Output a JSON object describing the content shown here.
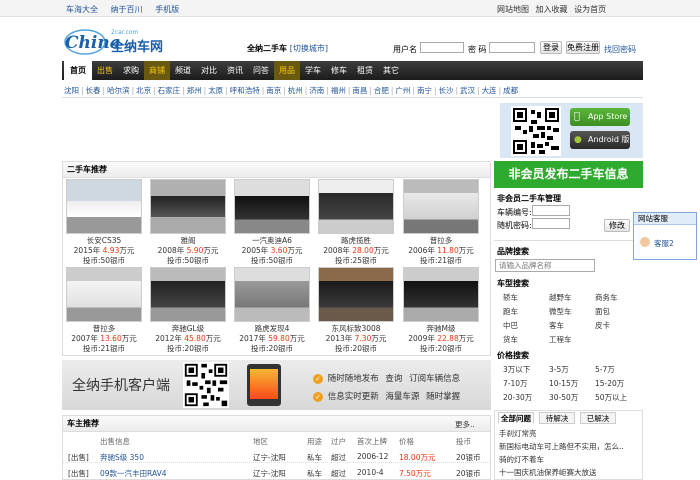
{
  "topbar": {
    "left_links": [
      "车海大全",
      "纳于百川",
      "手机版"
    ],
    "right_links": [
      "网站地图",
      "加入收藏",
      "设为首页"
    ]
  },
  "logo": {
    "text": "全纳车网",
    "sub": "2car.com"
  },
  "header": {
    "site_name": "全纳二手车",
    "switch_city": "[切换城市]",
    "username_label": "用户名",
    "password_label": "密 码",
    "login": "登录",
    "register": "免费注册",
    "forgot": "找回密码"
  },
  "nav": [
    "首页",
    "出售",
    "求购",
    "商铺",
    "频道",
    "对比",
    "资讯",
    "问答",
    "用品",
    "学车",
    "修车",
    "租赁",
    "其它"
  ],
  "cities": [
    "沈阳",
    "长春",
    "哈尔滨",
    "北京",
    "石家庄",
    "郑州",
    "太原",
    "呼和浩特",
    "南京",
    "杭州",
    "济南",
    "福州",
    "南昌",
    "合肥",
    "广州",
    "南宁",
    "长沙",
    "武汉",
    "大连",
    "成都"
  ],
  "app": {
    "appstore": "App Store",
    "android": "Android 版"
  },
  "used_cars": {
    "title": "二手车推荐",
    "items": [
      {
        "name": "长安CS35",
        "year": "2015年",
        "price": "4.93",
        "unit": "万元",
        "coins": "投币:50银币"
      },
      {
        "name": "雅阁",
        "year": "2008年",
        "price": "5.90",
        "unit": "万元",
        "coins": "投币:50银币"
      },
      {
        "name": "一汽奥迪A6",
        "year": "2005年",
        "price": "3.60",
        "unit": "万元",
        "coins": "投币:50银币"
      },
      {
        "name": "路虎揽胜",
        "year": "2008年",
        "price": "28.00",
        "unit": "万元",
        "coins": "投币:25银币"
      },
      {
        "name": "普拉多",
        "year": "2006年",
        "price": "11.80",
        "unit": "万元",
        "coins": "投币:21银币"
      },
      {
        "name": "普拉多",
        "year": "2007年",
        "price": "13.60",
        "unit": "万元",
        "coins": "投币:21银币"
      },
      {
        "name": "奔驰GL级",
        "year": "2012年",
        "price": "45.80",
        "unit": "万元",
        "coins": "投币:20银币"
      },
      {
        "name": "路虎发现4",
        "year": "2017年",
        "price": "59.80",
        "unit": "万元",
        "coins": "投币:20银币"
      },
      {
        "name": "东风标致3008",
        "year": "2013年",
        "price": "7.30",
        "unit": "万元",
        "coins": "投币:20银币"
      },
      {
        "name": "奔驰M级",
        "year": "2009年",
        "price": "22.88",
        "unit": "万元",
        "coins": "投币:20银币"
      }
    ]
  },
  "right": {
    "banner": "非会员发布二手车信息",
    "manage_title": "非会员二手车管理",
    "plate_label": "车辆编号:",
    "pwd_label": "随机密码:",
    "edit_btn": "修改",
    "brand_title": "品牌搜索",
    "brand_placeholder": "请输入品牌名称",
    "type_title": "车型搜索",
    "types": [
      "轿车",
      "越野车",
      "商务车",
      "跑车",
      "微型车",
      "面包",
      "中巴",
      "客车",
      "皮卡",
      "货车",
      "工程车"
    ],
    "price_title": "价格搜索",
    "prices": [
      "3万以下",
      "3-5万",
      "5-7万",
      "7-10万",
      "10-15万",
      "15-20万",
      "20-30万",
      "30-50万",
      "50万以上"
    ]
  },
  "service": {
    "title": "网站客服",
    "agent": "客服2"
  },
  "mobile_banner": {
    "title": "全纳手机客户端",
    "features": [
      "随时随地发布",
      "查询",
      "订阅车辆信息",
      "信息实时更新",
      "海量车源",
      "随时掌握"
    ]
  },
  "owners": {
    "title": "车主推荐",
    "more": "更多..",
    "headers": [
      "出售信息",
      "地区",
      "用途",
      "过户",
      "首次上牌",
      "价格",
      "投币"
    ],
    "rows": [
      [
        "[出售]",
        "奔驰S级 350",
        "辽宁-沈阳",
        "私车",
        "超过",
        "2006-12",
        "18.00万元",
        "20银币"
      ],
      [
        "[出售]",
        "09款一汽丰田RAV4",
        "辽宁-沈阳",
        "私车",
        "超过",
        "2010-4",
        "7.50万元",
        "20银币"
      ]
    ]
  },
  "qa": {
    "tabs": [
      "全部问题",
      "待解决",
      "已解决"
    ],
    "items": [
      "手刹灯常亮",
      "新国标电动车可上路但不实用，怎么..",
      "骑的灯不着车",
      "十一国庆机油保养岠赛大放送"
    ]
  }
}
